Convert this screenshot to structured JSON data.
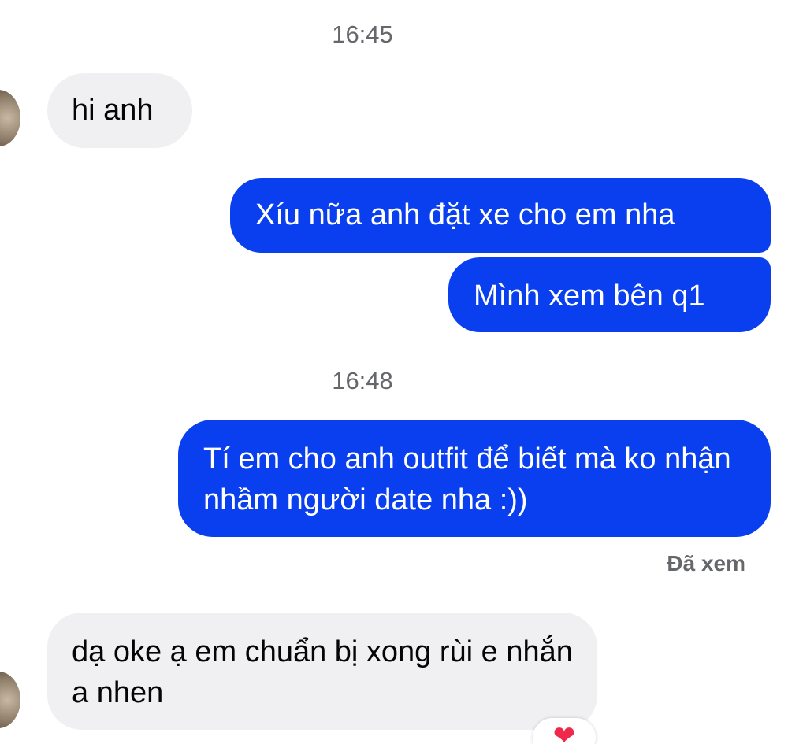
{
  "messages": [
    {
      "type": "timestamp",
      "text": "16:45"
    },
    {
      "type": "incoming",
      "text": "hi anh"
    },
    {
      "type": "outgoing",
      "text": "Xíu nữa anh đặt xe cho em nha"
    },
    {
      "type": "outgoing",
      "text": "Mình xem bên q1"
    },
    {
      "type": "timestamp",
      "text": "16:48"
    },
    {
      "type": "outgoing",
      "text": "Tí em cho anh outfit để biết mà ko nhận nhầm người date nha :))"
    },
    {
      "type": "status",
      "text": "Đã xem"
    },
    {
      "type": "incoming",
      "text": "dạ oke ạ em chuẩn bị xong rùi e nhắn a nhen"
    }
  ],
  "reaction": {
    "icon": "heart-icon",
    "glyph": "❤"
  },
  "colors": {
    "outgoing_bubble": "#0a3ff0",
    "incoming_bubble": "#f0f0f3",
    "meta_text": "#65676b",
    "reaction_heart": "#f02849"
  }
}
